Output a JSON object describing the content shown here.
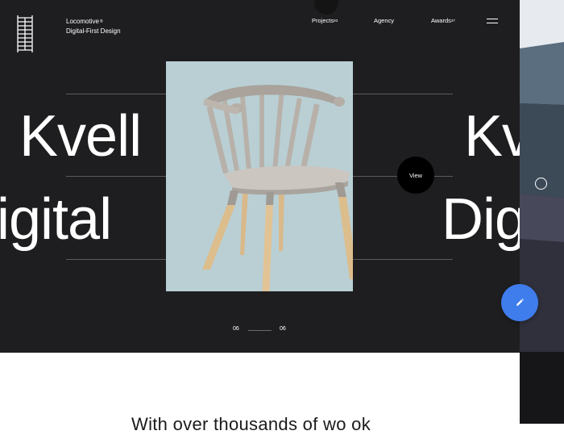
{
  "header": {
    "brand_line1": "Locomotive",
    "brand_sup": "®",
    "brand_line2": "Digital-First Design",
    "nav": [
      {
        "label": "Projects",
        "sup": "93"
      },
      {
        "label": "Agency",
        "sup": ""
      },
      {
        "label": "Awards",
        "sup": "37"
      }
    ]
  },
  "hero": {
    "word_left_1": "Kvell",
    "word_left_2": "igital",
    "word_right_1": "Kv",
    "word_right_2": "Digi",
    "view_label": "View",
    "counter_current": "06",
    "counter_total": "06"
  },
  "lower": {
    "text": "With over thousands of wo ok"
  },
  "colors": {
    "hero_bg": "#1e1e20",
    "photo_bg": "#b9cfd4",
    "fab": "#3f7cec"
  },
  "icons": [
    "logo-icon",
    "hamburger-menu-icon",
    "pencil-icon",
    "circle-icon"
  ]
}
